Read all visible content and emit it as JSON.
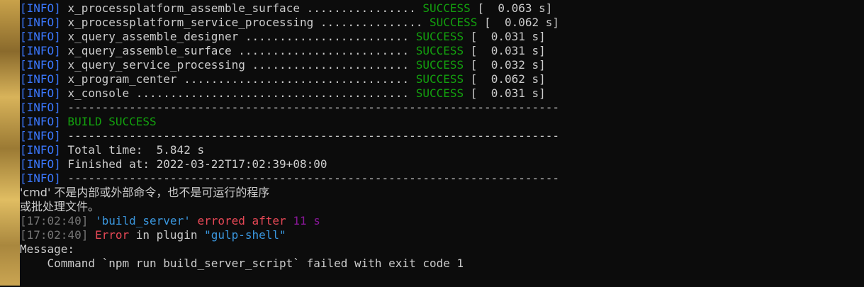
{
  "modules": [
    {
      "name": "x_processplatform_assemble_surface",
      "dots": " ................ ",
      "status": "SUCCESS",
      "time": "[  0.063 s]"
    },
    {
      "name": "x_processplatform_service_processing",
      "dots": " ............... ",
      "status": "SUCCESS",
      "time": "[  0.062 s]"
    },
    {
      "name": "x_query_assemble_designer",
      "dots": " ........................ ",
      "status": "SUCCESS",
      "time": "[  0.031 s]"
    },
    {
      "name": "x_query_assemble_surface",
      "dots": " ......................... ",
      "status": "SUCCESS",
      "time": "[  0.031 s]"
    },
    {
      "name": "x_query_service_processing",
      "dots": " ....................... ",
      "status": "SUCCESS",
      "time": "[  0.032 s]"
    },
    {
      "name": "x_program_center",
      "dots": " ................................. ",
      "status": "SUCCESS",
      "time": "[  0.062 s]"
    },
    {
      "name": "x_console",
      "dots": " ........................................ ",
      "status": "SUCCESS",
      "time": "[  0.031 s]"
    }
  ],
  "info_tag": "[INFO]",
  "separator": " ------------------------------------------------------------------------",
  "build_success": " BUILD SUCCESS",
  "total_time": " Total time:  5.842 s",
  "finished_at": " Finished at: 2022-03-22T17:02:39+08:00",
  "cmd_error_line1": "'cmd' 不是内部或外部命令，也不是可运行的程序",
  "cmd_error_line2": "或批处理文件。",
  "gulp": {
    "timestamp1": "[17:02:40]",
    "task_name": "'build_server'",
    "errored_after": " errored after ",
    "duration": "11 s",
    "timestamp2": "[17:02:40]",
    "error_word": " Error",
    "in_plugin": " in plugin ",
    "plugin_name": "\"gulp-shell\""
  },
  "message_label": "Message:",
  "message_text": "    Command `npm run build_server_script` failed with exit code 1"
}
